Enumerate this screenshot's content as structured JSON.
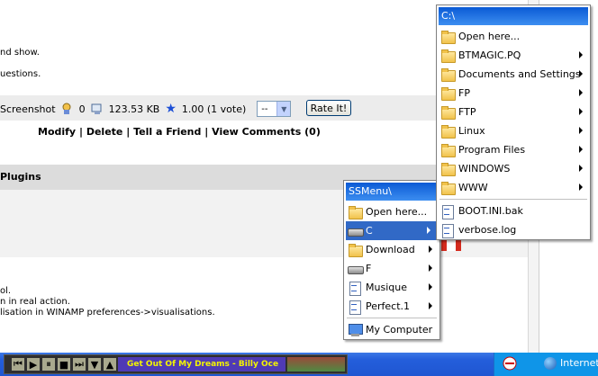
{
  "page": {
    "lines_top": [
      "nd show.",
      "uestions."
    ],
    "stats": {
      "screenshot_label": "Screenshot",
      "screenshot_count": "0",
      "size": "123.53 KB",
      "rating": "1.00 (1 vote)",
      "rate_select_value": "--",
      "rate_button": "Rate It!"
    },
    "links": [
      "Modify",
      "Delete",
      "Tell a Friend",
      "View Comments (0)"
    ],
    "link_sep": "|",
    "section_title": "Plugins",
    "lines_bottom": [
      "ol.",
      "n in real action.",
      "lisation in WINAMP preferences->visualisations."
    ]
  },
  "menu_ssmenu": {
    "title": "SSMenu\\",
    "items": [
      {
        "label": "Open here...",
        "icon": "folder-icon",
        "submenu": false
      },
      {
        "label": "C",
        "icon": "drive-icon",
        "submenu": true,
        "highlighted": true
      },
      {
        "label": "Download",
        "icon": "folder-icon",
        "submenu": true
      },
      {
        "label": "F",
        "icon": "drive-icon",
        "submenu": true
      },
      {
        "label": "Musique",
        "icon": "document-icon",
        "submenu": true
      },
      {
        "label": "Perfect.1",
        "icon": "document-icon",
        "submenu": true
      }
    ],
    "footer_item": {
      "label": "My Computer",
      "icon": "computer-icon"
    }
  },
  "menu_c": {
    "title": "C:\\",
    "items": [
      {
        "label": "Open here...",
        "submenu": false
      },
      {
        "label": "BTMAGIC.PQ",
        "submenu": true
      },
      {
        "label": "Documents and Settings",
        "submenu": true
      },
      {
        "label": "FP",
        "submenu": true
      },
      {
        "label": "FTP",
        "submenu": true
      },
      {
        "label": "Linux",
        "submenu": true
      },
      {
        "label": "Program Files",
        "submenu": true
      },
      {
        "label": "WINDOWS",
        "submenu": true
      },
      {
        "label": "WWW",
        "submenu": true
      }
    ],
    "files": [
      {
        "label": "BOOT.INI.bak"
      },
      {
        "label": "verbose.log"
      }
    ]
  },
  "taskbar": {
    "winamp_title": "Get Out Of My Dreams - Billy Oce",
    "winamp_controls": [
      "⏮",
      "▶",
      "⏸",
      "■",
      "⏭",
      "▼",
      "▲"
    ],
    "tray_zone": "Internet"
  }
}
